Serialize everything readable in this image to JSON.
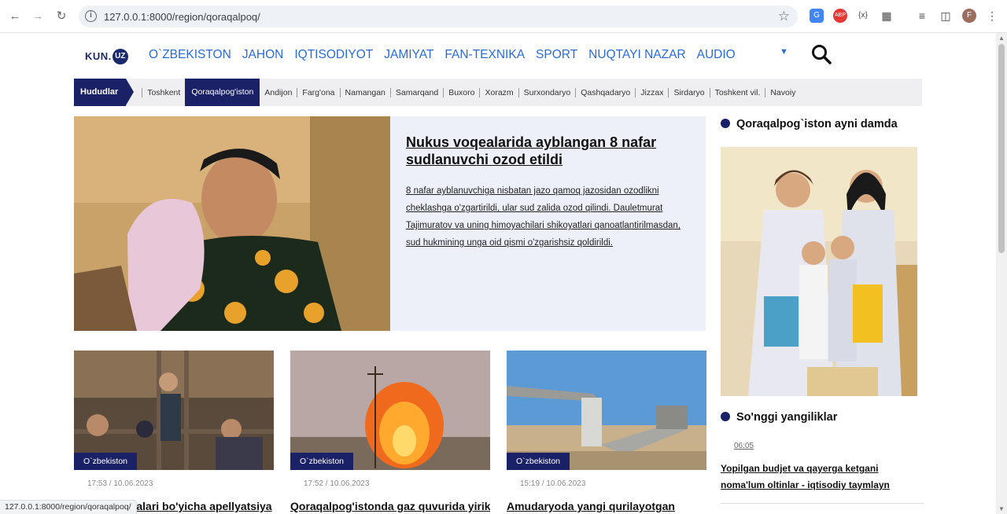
{
  "browser": {
    "url": "127.0.0.1:8000/region/qoraqalpoq/",
    "extensions": [
      "translate-icon",
      "adblock-icon",
      "code-icon",
      "puzzle-icon"
    ],
    "profile_initial": "F",
    "status_url": "127.0.0.1:8000/region/qoraqalpoq/"
  },
  "site": {
    "logo_text": "KUN.",
    "logo_badge": "UZ",
    "nav": [
      "O`ZBEKISTON",
      "JAHON",
      "IQTISODIYOT",
      "JAMIYAT",
      "FAN-TEXNIKA",
      "SPORT",
      "NUQTAYI NAZAR",
      "AUDIO"
    ]
  },
  "regions": {
    "label": "Hududlar",
    "items": [
      "Toshkent",
      "Qoraqalpog'iston",
      "Andijon",
      "Farg'ona",
      "Namangan",
      "Samarqand",
      "Buxoro",
      "Xorazm",
      "Surxondaryo",
      "Qashqadaryo",
      "Jizzax",
      "Sirdaryo",
      "Toshkent vil.",
      "Navoiy"
    ],
    "active": "Qoraqalpog'iston"
  },
  "hero": {
    "title": "Nukus voqealarida ayblangan 8 nafar sudlanuvchi ozod etildi",
    "description": "8 nafar ayblanuvchiga nisbatan jazo qamoq jazosidan ozodlikni cheklashga o'zgartirildi, ular sud zalida ozod qilindi. Dauletmurat Tajimuratov va uning himoyachilari shikoyatlari qanoatlantirilmasdan, sud hukmining unga oid qismi o'zgarishsiz qoldirildi."
  },
  "cards": [
    {
      "tag": "O`zbekiston",
      "time": "17:53 / 10.06.2023",
      "title": "Nukus voqealari bo'yicha apellyatsiya"
    },
    {
      "tag": "O`zbekiston",
      "time": "17:52 / 10.06.2023",
      "title": "Qoraqalpog'istonda gaz quvurida yirik"
    },
    {
      "tag": "O`zbekiston",
      "time": "15:19 / 10.06.2023",
      "title": "Amudaryoda yangi qurilayotgan"
    }
  ],
  "sidebar": {
    "section1": "Qoraqalpog`iston ayni damda",
    "section2": "So'nggi yangiliklar",
    "latest_time": "06:05",
    "latest_title": "Yopilgan budjet va qayerga ketgani noma'lum oltinlar - iqtisodiy taymlayn"
  }
}
